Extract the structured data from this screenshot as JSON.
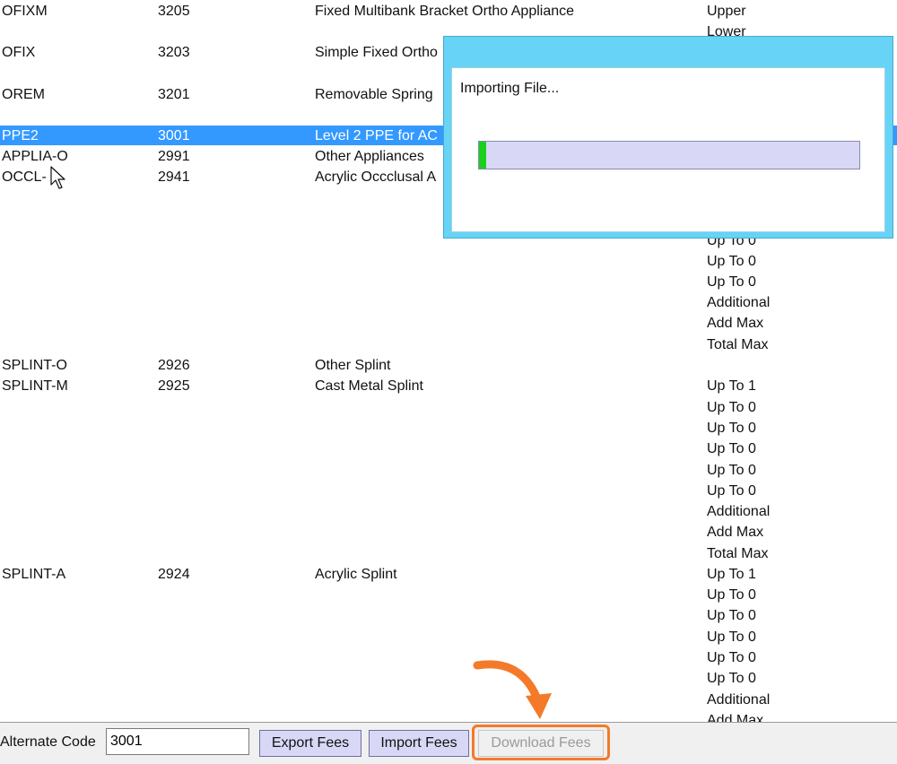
{
  "rows": [
    {
      "code": "OFIXM",
      "num": "3205",
      "desc": "Fixed Multibank Bracket Ortho Appliance",
      "qualifiers": [
        "Upper",
        "Lower"
      ]
    },
    {
      "code": "OFIX",
      "num": "3203",
      "desc": "Simple Fixed Ortho",
      "qualifiers": []
    },
    {
      "code": "OREM",
      "num": "3201",
      "desc": "Removable Spring",
      "qualifiers": []
    },
    {
      "code": "PPE2",
      "num": "3001",
      "desc": "Level 2 PPE for AC",
      "qualifiers": [],
      "selected": true
    },
    {
      "code": "APPLIA-O",
      "num": "2991",
      "desc": "Other Appliances",
      "qualifiers": []
    },
    {
      "code": "OCCL-",
      "num": "2941",
      "desc": "Acrylic Occclusal A",
      "qualifiers": [
        "Up To 0",
        "Up To 0",
        "Up To 0",
        "Additional",
        "Add Max",
        "Total Max"
      ]
    },
    {
      "code": "SPLINT-O",
      "num": "2926",
      "desc": "Other Splint",
      "qualifiers": []
    },
    {
      "code": "SPLINT-M",
      "num": "2925",
      "desc": "Cast Metal Splint",
      "qualifiers": [
        "Up To 1",
        "Up To 0",
        "Up To 0",
        "Up To 0",
        "Up To 0",
        "Up To 0",
        "Additional",
        "Add Max",
        "Total Max"
      ]
    },
    {
      "code": "SPLINT-A",
      "num": "2924",
      "desc": "Acrylic Splint",
      "qualifiers": [
        "Up To 1",
        "Up To 0",
        "Up To 0",
        "Up To 0",
        "Up To 0",
        "Up To 0",
        "Additional",
        "Add Max"
      ]
    }
  ],
  "dialog": {
    "message": "Importing File...",
    "progress": 0.02
  },
  "footer": {
    "alt_code_label": "Alternate Code",
    "alt_code_value": "3001",
    "export_label": "Export Fees",
    "import_label": "Import Fees",
    "download_label": "Download Fees"
  },
  "colors": {
    "selection": "#3399ff",
    "dialog_frame": "#67d3f6",
    "progress_fill": "#19d11a",
    "highlight": "#f47a2a"
  }
}
